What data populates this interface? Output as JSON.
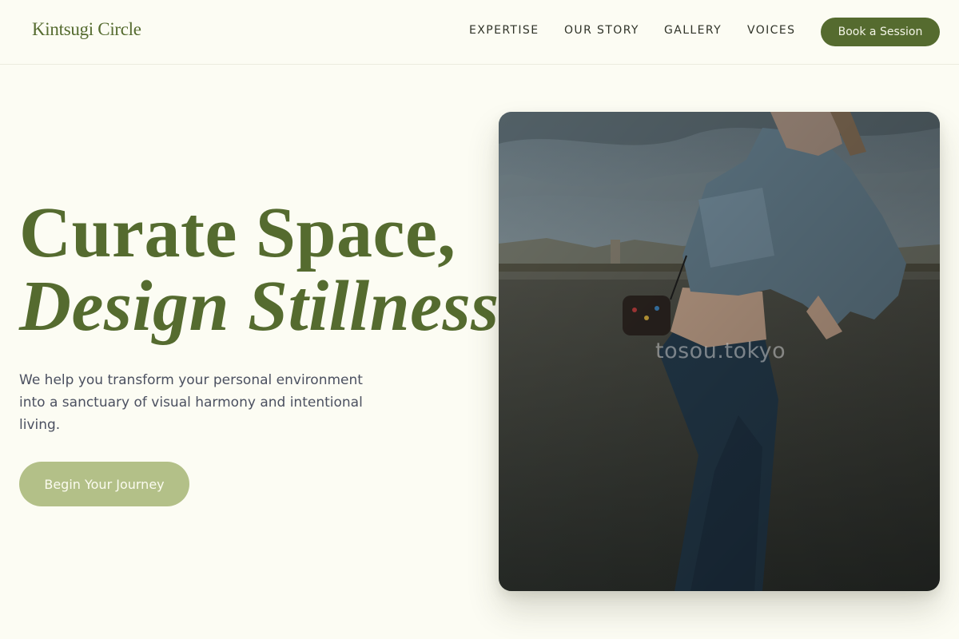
{
  "brand": {
    "name": "Kintsugi Circle"
  },
  "nav": {
    "links": [
      "EXPERTISE",
      "OUR STORY",
      "GALLERY",
      "VOICES"
    ],
    "cta_label": "Book a Session"
  },
  "hero": {
    "headline_line1": "Curate Space,",
    "headline_line2": "Design Stillness.",
    "subtext": "We help you transform your personal environment into a sanctuary of visual harmony and intentional living.",
    "cta_label": "Begin Your Journey",
    "image": {
      "watermark": "tosou.tokyo"
    }
  },
  "colors": {
    "background": "#fcfcf3",
    "brand_green": "#556b2f",
    "cta_light_green": "#b3c088",
    "body_text": "#4b5060"
  }
}
